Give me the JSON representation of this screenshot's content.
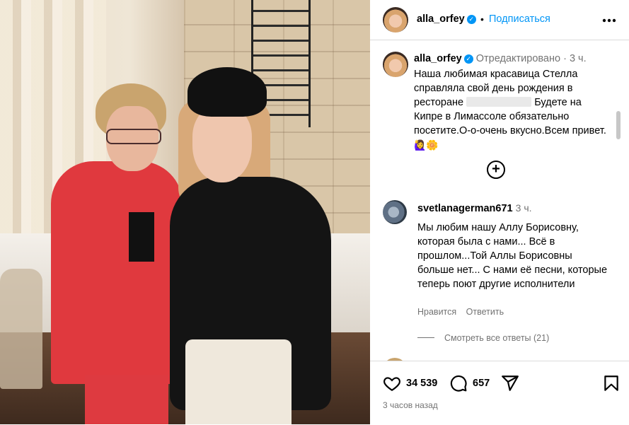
{
  "post": {
    "author": "alla_orfey",
    "follow_label": "Подписаться",
    "separator": "•",
    "more_label": "•••"
  },
  "caption": {
    "author": "alla_orfey",
    "edited_label": "Отредактировано",
    "separator": "·",
    "time": "3 ч.",
    "text_part1": "Наша любимая красавица Стелла справляла свой день рождения в ресторане",
    "text_part2": "Будете на Кипре в Лимассоле обязательно посетите.О-о-очень вкусно.Всем привет.",
    "emojis": "🙋‍♀️🌼"
  },
  "comment": {
    "author": "svetlanagerman671",
    "time": "3 ч.",
    "text": "Мы любим нашу Аллу Борисовну, которая была с нами... Всё в прошлом...Той Аллы Борисовны больше нет... С нами её песни, которые теперь поют другие исполнители",
    "like_label": "Нравится",
    "reply_label": "Ответить",
    "view_replies": "Смотреть все ответы (21)"
  },
  "stats": {
    "likes": "34 539",
    "comments": "657"
  },
  "posted_ago": "3 часов назад",
  "icons": {
    "header_more": "more-options-icon",
    "add": "add-comment-icon",
    "like": "heart-icon",
    "comment": "comment-bubble-icon",
    "share": "share-icon",
    "save": "bookmark-icon"
  }
}
